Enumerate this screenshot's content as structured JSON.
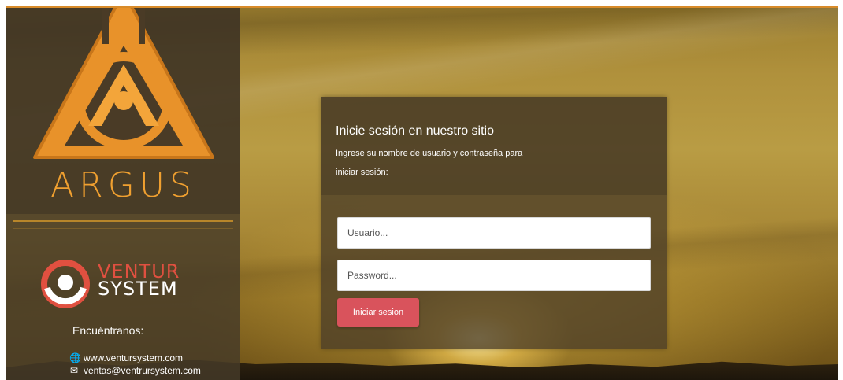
{
  "sidebar": {
    "brand_name": "ARGUS",
    "partner_brand_line1": "VENTUR",
    "partner_brand_line2": "SYSTEM",
    "find_us_label": "Encuéntranos:",
    "website": "www.ventursystem.com",
    "email": "ventas@ventrursystem.com"
  },
  "login": {
    "title": "Inicie sesión en nuestro sitio",
    "subtitle_line1": "Ingrese su nombre de usuario y contraseña para",
    "subtitle_line2": "iniciar sesión:",
    "username_placeholder": "Usuario...",
    "password_placeholder": "Password...",
    "submit_label": "Iniciar sesion"
  },
  "colors": {
    "accent_orange": "#f0a030",
    "button_red": "#d9535c",
    "ventur_red": "#e05040"
  }
}
